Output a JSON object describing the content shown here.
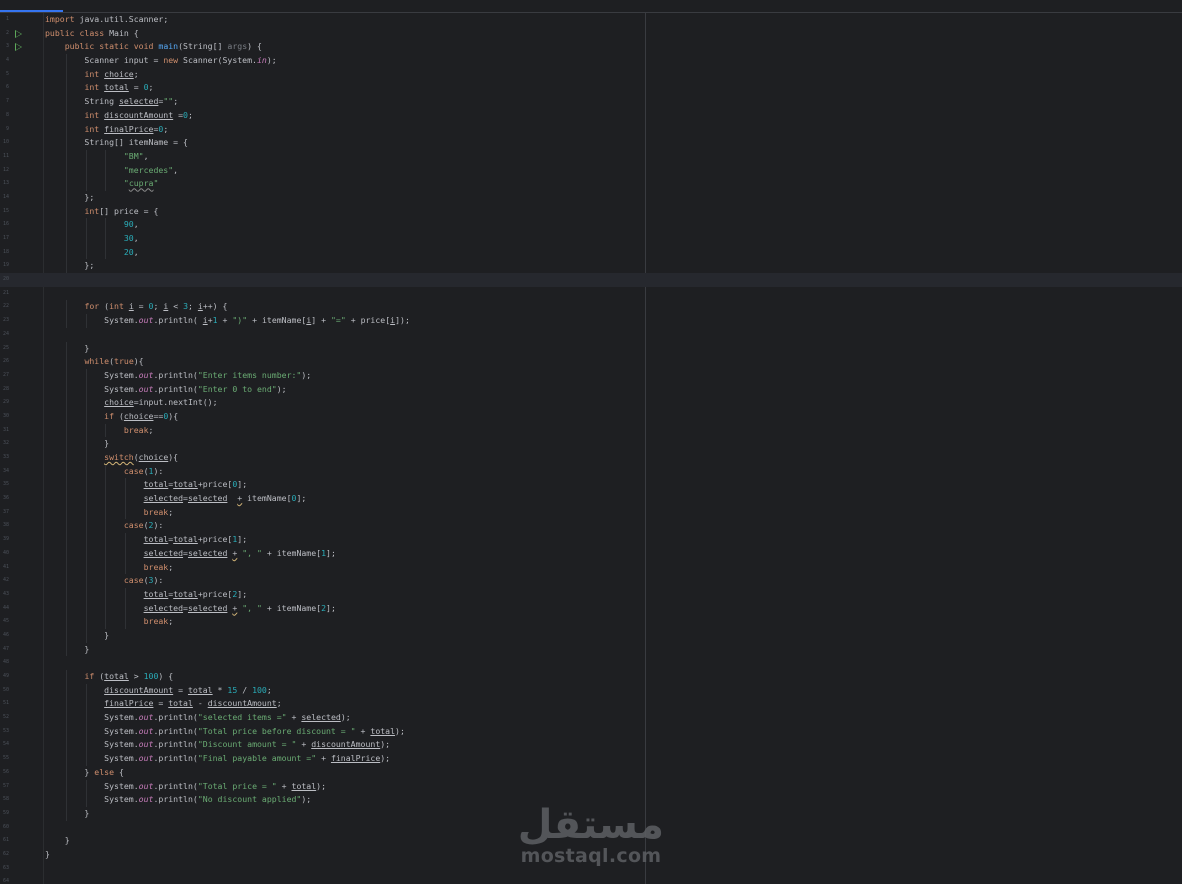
{
  "editor": {
    "accent": "#3574f0",
    "background": "#1e1f22",
    "current_line": 20,
    "run_gutter_icons": [
      2,
      3
    ]
  },
  "code_lines": [
    [
      [
        "kw",
        "import "
      ],
      [
        "",
        "java.util.Scanner;"
      ]
    ],
    [
      [
        "kw",
        "public class "
      ],
      [
        "",
        "Main {"
      ]
    ],
    [
      [
        "",
        "    "
      ],
      [
        "kw",
        "public static void "
      ],
      [
        "fn",
        "main"
      ],
      [
        "",
        "(String[] "
      ],
      [
        "par",
        "args"
      ],
      [
        "",
        ") {"
      ]
    ],
    [
      [
        "",
        "        Scanner input = "
      ],
      [
        "kw",
        "new "
      ],
      [
        "",
        "Scanner(System."
      ],
      [
        "fld",
        "in"
      ],
      [
        "",
        ");"
      ]
    ],
    [
      [
        "",
        "        "
      ],
      [
        "kw",
        "int "
      ],
      [
        "u",
        "choice"
      ],
      [
        "",
        ";"
      ]
    ],
    [
      [
        "",
        "        "
      ],
      [
        "kw",
        "int "
      ],
      [
        "u",
        "total"
      ],
      [
        "",
        " = "
      ],
      [
        "num",
        "0"
      ],
      [
        "",
        ";"
      ]
    ],
    [
      [
        "",
        "        String "
      ],
      [
        "u",
        "selected"
      ],
      [
        "",
        "="
      ],
      [
        "str",
        "\"\""
      ],
      [
        "",
        ";"
      ]
    ],
    [
      [
        "",
        "        "
      ],
      [
        "kw",
        "int "
      ],
      [
        "u",
        "discountAmount"
      ],
      [
        "",
        " ="
      ],
      [
        "num",
        "0"
      ],
      [
        "",
        ";"
      ]
    ],
    [
      [
        "",
        "        "
      ],
      [
        "kw",
        "int "
      ],
      [
        "u",
        "finalPrice"
      ],
      [
        "",
        "="
      ],
      [
        "num",
        "0"
      ],
      [
        "",
        ";"
      ]
    ],
    [
      [
        "",
        "        String[] itemName = {"
      ]
    ],
    [
      [
        "",
        "                "
      ],
      [
        "str",
        "\"BM\""
      ],
      [
        "",
        ","
      ]
    ],
    [
      [
        "",
        "                "
      ],
      [
        "str",
        "\"mercedes\""
      ],
      [
        "",
        ","
      ]
    ],
    [
      [
        "",
        "                "
      ],
      [
        "str",
        "\""
      ],
      [
        "str sq",
        "cupra"
      ],
      [
        "str",
        "\""
      ]
    ],
    [
      [
        "",
        "        };"
      ]
    ],
    [
      [
        "",
        "        "
      ],
      [
        "kw",
        "int"
      ],
      [
        "",
        "[] price = {"
      ]
    ],
    [
      [
        "",
        "                "
      ],
      [
        "num",
        "90"
      ],
      [
        "",
        ","
      ]
    ],
    [
      [
        "",
        "                "
      ],
      [
        "num",
        "30"
      ],
      [
        "",
        ","
      ]
    ],
    [
      [
        "",
        "                "
      ],
      [
        "num",
        "20"
      ],
      [
        "",
        ","
      ]
    ],
    [
      [
        "",
        "        };"
      ]
    ],
    [
      [
        "",
        ""
      ]
    ],
    [
      [
        "",
        ""
      ]
    ],
    [
      [
        "",
        "        "
      ],
      [
        "kw",
        "for "
      ],
      [
        "",
        "("
      ],
      [
        "kw",
        "int "
      ],
      [
        "u",
        "i"
      ],
      [
        "",
        " = "
      ],
      [
        "num",
        "0"
      ],
      [
        "",
        "; "
      ],
      [
        "u",
        "i"
      ],
      [
        "",
        " < "
      ],
      [
        "num",
        "3"
      ],
      [
        "",
        "; "
      ],
      [
        "u",
        "i"
      ],
      [
        "",
        "++) {"
      ]
    ],
    [
      [
        "",
        "            System."
      ],
      [
        "fld",
        "out"
      ],
      [
        "",
        ".println( "
      ],
      [
        "u",
        "i"
      ],
      [
        "",
        "+"
      ],
      [
        "num",
        "1"
      ],
      [
        "",
        " + "
      ],
      [
        "str",
        "\")\""
      ],
      [
        "",
        " + itemName["
      ],
      [
        "u",
        "i"
      ],
      [
        "",
        "] + "
      ],
      [
        "str",
        "\"=\""
      ],
      [
        "",
        " + price["
      ],
      [
        "u",
        "i"
      ],
      [
        "",
        "]);"
      ]
    ],
    [
      [
        "",
        ""
      ]
    ],
    [
      [
        "",
        "        }"
      ]
    ],
    [
      [
        "",
        "        "
      ],
      [
        "kw",
        "while"
      ],
      [
        "",
        "("
      ],
      [
        "kw",
        "true"
      ],
      [
        "",
        "){"
      ]
    ],
    [
      [
        "",
        "            System."
      ],
      [
        "fld",
        "out"
      ],
      [
        "",
        ".println("
      ],
      [
        "str",
        "\"Enter items number:\""
      ],
      [
        "",
        ");"
      ]
    ],
    [
      [
        "",
        "            System."
      ],
      [
        "fld",
        "out"
      ],
      [
        "",
        ".println("
      ],
      [
        "str",
        "\"Enter 0 to end\""
      ],
      [
        "",
        ");"
      ]
    ],
    [
      [
        "",
        "            "
      ],
      [
        "u",
        "choice"
      ],
      [
        "",
        "=input.nextInt();"
      ]
    ],
    [
      [
        "",
        "            "
      ],
      [
        "kw",
        "if "
      ],
      [
        "",
        "("
      ],
      [
        "u",
        "choice"
      ],
      [
        "",
        "=="
      ],
      [
        "num",
        "0"
      ],
      [
        "",
        "){"
      ]
    ],
    [
      [
        "",
        "                "
      ],
      [
        "kw",
        "break"
      ],
      [
        "",
        ";"
      ]
    ],
    [
      [
        "",
        "            }"
      ]
    ],
    [
      [
        "",
        "            "
      ],
      [
        "kw w",
        "switch"
      ],
      [
        "",
        "("
      ],
      [
        "u",
        "choice"
      ],
      [
        "",
        "){"
      ]
    ],
    [
      [
        "",
        "                "
      ],
      [
        "kw",
        "case"
      ],
      [
        "",
        "("
      ],
      [
        "num",
        "1"
      ],
      [
        "",
        "):"
      ]
    ],
    [
      [
        "",
        "                    "
      ],
      [
        "u",
        "total"
      ],
      [
        "",
        "="
      ],
      [
        "u",
        "total"
      ],
      [
        "",
        "+price["
      ],
      [
        "num",
        "0"
      ],
      [
        "",
        "];"
      ]
    ],
    [
      [
        "",
        "                    "
      ],
      [
        "u",
        "selected"
      ],
      [
        "",
        "="
      ],
      [
        "u",
        "selected"
      ],
      [
        "",
        "  "
      ],
      [
        "w",
        "+"
      ],
      [
        "",
        " itemName["
      ],
      [
        "num",
        "0"
      ],
      [
        "",
        "];"
      ]
    ],
    [
      [
        "",
        "                    "
      ],
      [
        "kw",
        "break"
      ],
      [
        "",
        ";"
      ]
    ],
    [
      [
        "",
        "                "
      ],
      [
        "kw",
        "case"
      ],
      [
        "",
        "("
      ],
      [
        "num",
        "2"
      ],
      [
        "",
        "):"
      ]
    ],
    [
      [
        "",
        "                    "
      ],
      [
        "u",
        "total"
      ],
      [
        "",
        "="
      ],
      [
        "u",
        "total"
      ],
      [
        "",
        "+price["
      ],
      [
        "num",
        "1"
      ],
      [
        "",
        "];"
      ]
    ],
    [
      [
        "",
        "                    "
      ],
      [
        "u",
        "selected"
      ],
      [
        "",
        "="
      ],
      [
        "u",
        "selected"
      ],
      [
        "",
        " "
      ],
      [
        "w",
        "+"
      ],
      [
        "",
        " "
      ],
      [
        "str",
        "\", \""
      ],
      [
        "",
        " + itemName["
      ],
      [
        "num",
        "1"
      ],
      [
        "",
        "];"
      ]
    ],
    [
      [
        "",
        "                    "
      ],
      [
        "kw",
        "break"
      ],
      [
        "",
        ";"
      ]
    ],
    [
      [
        "",
        "                "
      ],
      [
        "kw",
        "case"
      ],
      [
        "",
        "("
      ],
      [
        "num",
        "3"
      ],
      [
        "",
        "):"
      ]
    ],
    [
      [
        "",
        "                    "
      ],
      [
        "u",
        "total"
      ],
      [
        "",
        "="
      ],
      [
        "u",
        "total"
      ],
      [
        "",
        "+price["
      ],
      [
        "num",
        "2"
      ],
      [
        "",
        "];"
      ]
    ],
    [
      [
        "",
        "                    "
      ],
      [
        "u",
        "selected"
      ],
      [
        "",
        "="
      ],
      [
        "u",
        "selected"
      ],
      [
        "",
        " "
      ],
      [
        "w",
        "+"
      ],
      [
        "",
        " "
      ],
      [
        "str",
        "\", \""
      ],
      [
        "",
        " + itemName["
      ],
      [
        "num",
        "2"
      ],
      [
        "",
        "];"
      ]
    ],
    [
      [
        "",
        "                    "
      ],
      [
        "kw",
        "break"
      ],
      [
        "",
        ";"
      ]
    ],
    [
      [
        "",
        "            }"
      ]
    ],
    [
      [
        "",
        "        }"
      ]
    ],
    [
      [
        "",
        ""
      ]
    ],
    [
      [
        "",
        "        "
      ],
      [
        "kw",
        "if "
      ],
      [
        "",
        "("
      ],
      [
        "u",
        "total"
      ],
      [
        "",
        " > "
      ],
      [
        "num",
        "100"
      ],
      [
        "",
        ") {"
      ]
    ],
    [
      [
        "",
        "            "
      ],
      [
        "u",
        "discountAmount"
      ],
      [
        "",
        " = "
      ],
      [
        "u",
        "total"
      ],
      [
        "",
        " * "
      ],
      [
        "num",
        "15"
      ],
      [
        "",
        " / "
      ],
      [
        "num",
        "100"
      ],
      [
        "",
        ";"
      ]
    ],
    [
      [
        "",
        "            "
      ],
      [
        "u",
        "finalPrice"
      ],
      [
        "",
        " = "
      ],
      [
        "u",
        "total"
      ],
      [
        "",
        " - "
      ],
      [
        "u",
        "discountAmount"
      ],
      [
        "",
        ";"
      ]
    ],
    [
      [
        "",
        "            System."
      ],
      [
        "fld",
        "out"
      ],
      [
        "",
        ".println("
      ],
      [
        "str",
        "\"selected items =\""
      ],
      [
        "",
        " + "
      ],
      [
        "u",
        "selected"
      ],
      [
        "",
        ");"
      ]
    ],
    [
      [
        "",
        "            System."
      ],
      [
        "fld",
        "out"
      ],
      [
        "",
        ".println("
      ],
      [
        "str",
        "\"Total price before discount = \""
      ],
      [
        "",
        " + "
      ],
      [
        "u",
        "total"
      ],
      [
        "",
        ");"
      ]
    ],
    [
      [
        "",
        "            System."
      ],
      [
        "fld",
        "out"
      ],
      [
        "",
        ".println("
      ],
      [
        "str",
        "\"Discount amount = \""
      ],
      [
        "",
        " + "
      ],
      [
        "u",
        "discountAmount"
      ],
      [
        "",
        ");"
      ]
    ],
    [
      [
        "",
        "            System."
      ],
      [
        "fld",
        "out"
      ],
      [
        "",
        ".println("
      ],
      [
        "str",
        "\"Final payable amount =\""
      ],
      [
        "",
        " + "
      ],
      [
        "u",
        "finalPrice"
      ],
      [
        "",
        ");"
      ]
    ],
    [
      [
        "",
        "        } "
      ],
      [
        "kw",
        "else "
      ],
      [
        "",
        "{"
      ]
    ],
    [
      [
        "",
        "            System."
      ],
      [
        "fld",
        "out"
      ],
      [
        "",
        ".println("
      ],
      [
        "str",
        "\"Total price = \""
      ],
      [
        "",
        " + "
      ],
      [
        "u",
        "total"
      ],
      [
        "",
        ");"
      ]
    ],
    [
      [
        "",
        "            System."
      ],
      [
        "fld",
        "out"
      ],
      [
        "",
        ".println("
      ],
      [
        "str",
        "\"No discount applied\""
      ],
      [
        "",
        ");"
      ]
    ],
    [
      [
        "",
        "        }"
      ]
    ],
    [
      [
        "",
        ""
      ]
    ],
    [
      [
        "",
        "    }"
      ]
    ],
    [
      [
        "",
        "}"
      ]
    ],
    [
      [
        "",
        ""
      ]
    ],
    [
      [
        "",
        ""
      ]
    ]
  ],
  "watermark": {
    "arabic": "مستقل",
    "latin": "mostaql.com"
  }
}
